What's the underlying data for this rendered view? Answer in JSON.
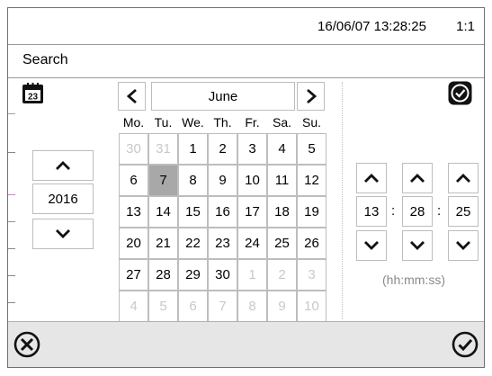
{
  "status": {
    "datetime": "16/06/07 13:28:25",
    "zoom": "1:1"
  },
  "title": "Search",
  "calendar": {
    "month": "June",
    "prev_label": "<",
    "next_label": ">",
    "weekdays": [
      "Mo.",
      "Tu.",
      "We.",
      "Th.",
      "Fr.",
      "Sa.",
      "Su."
    ],
    "weeks": [
      [
        "30",
        "31",
        "1",
        "2",
        "3",
        "4",
        "5"
      ],
      [
        "6",
        "7",
        "8",
        "9",
        "10",
        "11",
        "12"
      ],
      [
        "13",
        "14",
        "15",
        "16",
        "17",
        "18",
        "19"
      ],
      [
        "20",
        "21",
        "22",
        "23",
        "24",
        "25",
        "26"
      ],
      [
        "27",
        "28",
        "29",
        "30",
        "1",
        "2",
        "3"
      ],
      [
        "4",
        "5",
        "6",
        "7",
        "8",
        "9",
        "10"
      ]
    ],
    "selected_day": "7",
    "year": "2016"
  },
  "time": {
    "hh": "13",
    "mm": "28",
    "ss": "25",
    "separator": ":",
    "format_hint": "(hh:mm:ss)"
  },
  "icons": {
    "calendar": "calendar-icon",
    "clock": "clock-icon",
    "cancel": "cancel-x-icon",
    "confirm": "checkmark-icon"
  }
}
